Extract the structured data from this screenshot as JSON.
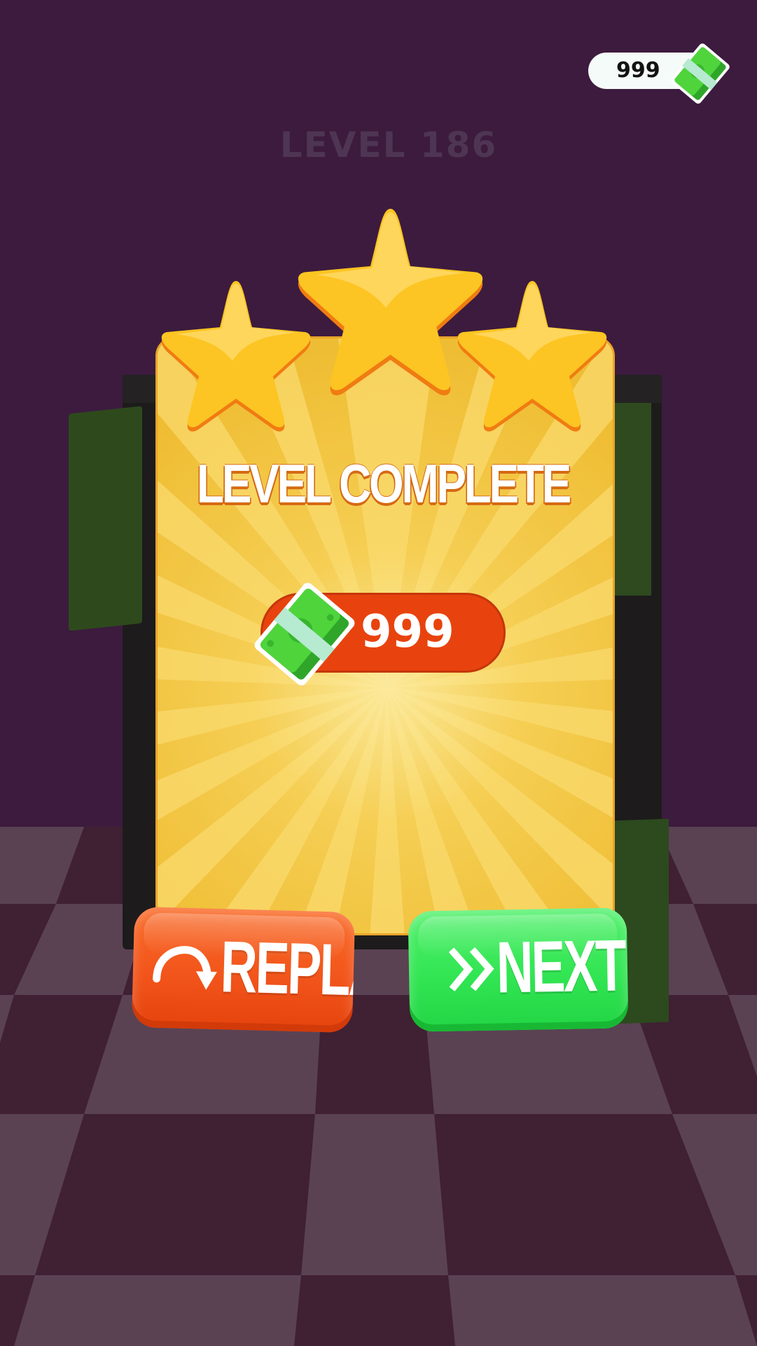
{
  "header": {
    "level_title": "LEVEL 186",
    "currency_value": "999",
    "currency_icon": "cash-icon"
  },
  "popup": {
    "heading": "LEVEL COMPLETE",
    "stars_earned": 3,
    "stars_total": 3,
    "reward_value": "999",
    "reward_icon": "cash-icon"
  },
  "buttons": {
    "replay_label": "REPLAY",
    "replay_icon": "replay-arrow-icon",
    "next_label": "NEXT",
    "next_icon": "fast-forward-icon"
  },
  "colors": {
    "background": "#3c1b3e",
    "card": "#f3c33d",
    "reward_pill": "#e8430e",
    "replay_button": "#f2551b",
    "next_button": "#32e553",
    "star": "#fcc523"
  }
}
